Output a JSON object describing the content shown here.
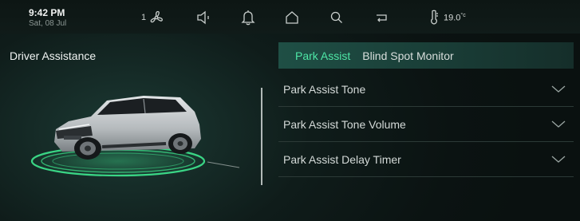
{
  "status_bar": {
    "time": "9:42 PM",
    "date": "Sat, 08 Jul",
    "fan_level": "1",
    "temperature": "19.0",
    "temperature_unit": "°c",
    "icons": [
      "fan-icon",
      "volume-icon",
      "bell-icon",
      "home-icon",
      "search-icon",
      "media-icon",
      "thermometer-icon"
    ]
  },
  "page": {
    "title": "Driver Assistance"
  },
  "tabs": [
    {
      "label": "Park Assist",
      "active": true
    },
    {
      "label": "Blind Spot Monitor",
      "active": false
    }
  ],
  "settings": [
    {
      "label": "Park Assist Tone"
    },
    {
      "label": "Park Assist Tone Volume"
    },
    {
      "label": "Park Assist Delay Timer"
    }
  ],
  "colors": {
    "accent": "#4ee6a6",
    "background": "#0f1c1a",
    "tab_bar": "#1f4f45",
    "vehicle_body": "#c3c8cb",
    "ring_glow": "#3ee88f"
  }
}
